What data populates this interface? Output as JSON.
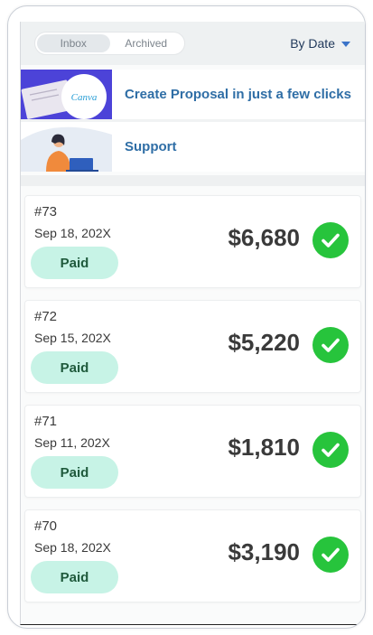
{
  "tabs": {
    "inbox": "Inbox",
    "archived": "Archived"
  },
  "sort": {
    "label": "By Date"
  },
  "promos": {
    "proposal": {
      "text": "Create Proposal in just a few clicks",
      "logo_text": "Canva"
    },
    "support": {
      "text": "Support"
    }
  },
  "invoices": [
    {
      "number": "#73",
      "date": "Sep 18, 202X",
      "status": "Paid",
      "amount": "$6,680"
    },
    {
      "number": "#72",
      "date": "Sep 15, 202X",
      "status": "Paid",
      "amount": "$5,220"
    },
    {
      "number": "#71",
      "date": "Sep 11, 202X",
      "status": "Paid",
      "amount": "$1,810"
    },
    {
      "number": "#70",
      "date": "Sep 18, 202X",
      "status": "Paid",
      "amount": "$3,190"
    }
  ],
  "colors": {
    "accent": "#2f6ea6",
    "paid_badge": "#c7f3e6",
    "check_green": "#27c43c",
    "thumb_purple": "#4c43d8"
  },
  "icons": {
    "sort": "caret-down-icon",
    "status": "check-circle-icon"
  }
}
